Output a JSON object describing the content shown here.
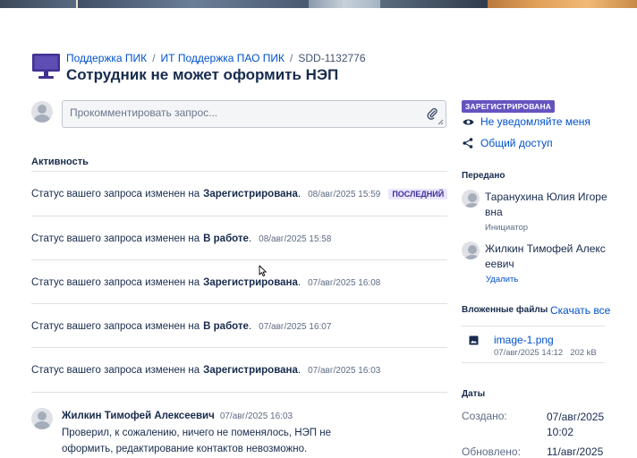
{
  "breadcrumb": {
    "items": [
      "Поддержка ПИК",
      "ИТ Поддержка ПАО ПИК"
    ],
    "issue_key": "SDD-1132776",
    "separator": "/"
  },
  "request": {
    "title": "Сотрудник не может оформить НЭП",
    "icon": "monitor-icon"
  },
  "comment_box": {
    "placeholder": "Прокомментировать запрос..."
  },
  "activity": {
    "heading": "Активность",
    "prefix": "Статус вашего запроса изменен на",
    "items": [
      {
        "status": "Зарегистрирована",
        "time": "08/авг/2025 15:59",
        "badge": "ПОСЛЕДНИЙ"
      },
      {
        "status": "В работе",
        "time": "08/авг/2025 15:58"
      },
      {
        "status": "Зарегистрирована",
        "time": "07/авг/2025 16:08"
      },
      {
        "status": "В работе",
        "time": "07/авг/2025 16:07"
      },
      {
        "status": "Зарегистрирована",
        "time": "07/авг/2025 16:03"
      }
    ],
    "comment": {
      "author": "Жилкин Тимофей Алексеевич",
      "time": "07/авг/2025 16:03",
      "text": "Проверил, к сожалению, ничего не поменялось, НЭП не оформить, редактирование контактов невозможно."
    }
  },
  "sidebar": {
    "status": "ЗАРЕГИСТРИРОВАНА",
    "status_color": "#6554c0",
    "notify_label": "Не уведомляйте меня",
    "share_label": "Общий доступ",
    "shared_heading": "Передано",
    "people": [
      {
        "name": "Таранухина Юлия Игоревна",
        "role": "Инициатор"
      },
      {
        "name": "Жилкин Тимофей Алексеевич",
        "action": "Удалить"
      }
    ],
    "attachments_heading": "Вложенные файлы",
    "download_all": "Скачать все",
    "file": {
      "name": "image-1.png",
      "date": "07/авг/2025 14:12",
      "size": "202 kB"
    },
    "dates_heading": "Даты",
    "dates": [
      {
        "label": "Создано:",
        "value": "07/авг/2025 10:02"
      },
      {
        "label": "Обновлено:",
        "value": "11/авг/2025"
      }
    ]
  },
  "colors": {
    "link": "#0052cc",
    "text": "#172b4d",
    "accent": "#6554c0"
  }
}
